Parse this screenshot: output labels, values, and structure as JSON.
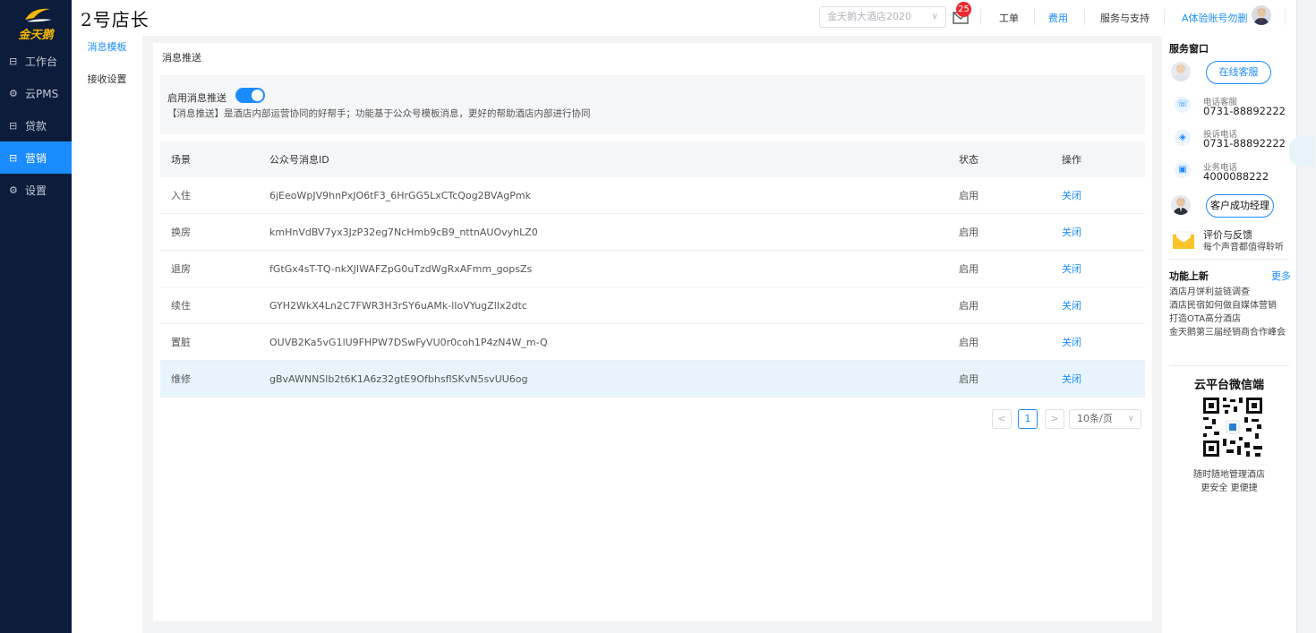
{
  "brand": {
    "logo_text": "金天鹅",
    "app_title": "2号店长"
  },
  "nav": {
    "items": [
      {
        "label": "工作台",
        "icon": "grid-icon"
      },
      {
        "label": "云PMS",
        "icon": "gear-icon"
      },
      {
        "label": "贷款",
        "icon": "grid-icon"
      },
      {
        "label": "营销",
        "icon": "grid-icon",
        "active": true
      },
      {
        "label": "设置",
        "icon": "gear-icon"
      }
    ]
  },
  "topbar": {
    "hotel_select": "金天鹅大酒店2020",
    "mail_badge": "25",
    "links": [
      "工单",
      "费用",
      "服务与支持"
    ],
    "account": "A体验账号勿删"
  },
  "subnav": {
    "items": [
      "消息模板",
      "接收设置"
    ],
    "active": 0
  },
  "main": {
    "title": "消息推送",
    "toggle_label": "启用消息推送",
    "toggle_on": true,
    "description": "【消息推送】是酒店内部运营协同的好帮手；功能基于公众号模板消息，更好的帮助酒店内部进行协同",
    "table": {
      "headers": [
        "场景",
        "公众号消息ID",
        "状态",
        "操作"
      ],
      "rows": [
        {
          "scene": "入住",
          "id": "6jEeoWpJV9hnPxJO6tF3_6HrGG5LxCTcQog2BVAgPmk",
          "status": "启用",
          "action": "关闭"
        },
        {
          "scene": "换房",
          "id": "kmHnVdBV7yx3JzP32eg7NcHmb9cB9_nttnAUOvyhLZ0",
          "status": "启用",
          "action": "关闭"
        },
        {
          "scene": "退房",
          "id": "fGtGx4sT-TQ-nkXJIWAFZpG0uTzdWgRxAFmm_gopsZs",
          "status": "启用",
          "action": "关闭"
        },
        {
          "scene": "续住",
          "id": "GYH2WkX4Ln2C7FWR3H3rSY6uAMk-lIoVYugZlIx2dtc",
          "status": "启用",
          "action": "关闭"
        },
        {
          "scene": "置脏",
          "id": "OUVB2Ka5vG1lU9FHPW7DSwFyVU0r0coh1P4zN4W_m-Q",
          "status": "启用",
          "action": "关闭"
        },
        {
          "scene": "维修",
          "id": "gBvAWNNSlb2t6K1A6z32gtE9OfbhsflSKvN5svUU6og",
          "status": "启用",
          "action": "关闭"
        }
      ]
    },
    "pager": {
      "prev": "<",
      "current": "1",
      "next": ">",
      "page_size": "10条/页"
    }
  },
  "right": {
    "service_title": "服务窗口",
    "online_service": "在线客服",
    "phone_label": "电话客服",
    "phone_number": "0731-88892222",
    "complaint_label": "投诉电话",
    "complaint_number": "0731-88892222",
    "business_label": "业务电话",
    "business_number": "4000088222",
    "success_manager": "客户成功经理",
    "feedback_title": "评价与反馈",
    "feedback_sub": "每个声音都值得聆听",
    "news_title": "功能上新",
    "news_more": "更多",
    "news": [
      "酒店月饼利益链调查",
      "酒店民宿如何做自媒体营销",
      "打造OTA高分酒店",
      "金天鹅第三届经销商合作峰会"
    ],
    "qr_title": "云平台微信端",
    "qr_cap1": "随时随地管理酒店",
    "qr_cap2": "更安全 更便捷"
  },
  "colors": {
    "accent": "#1a8cff",
    "nav_bg": "#0d1c3a",
    "logo_gold": "#f2b705",
    "badge_red": "#f0262a"
  }
}
